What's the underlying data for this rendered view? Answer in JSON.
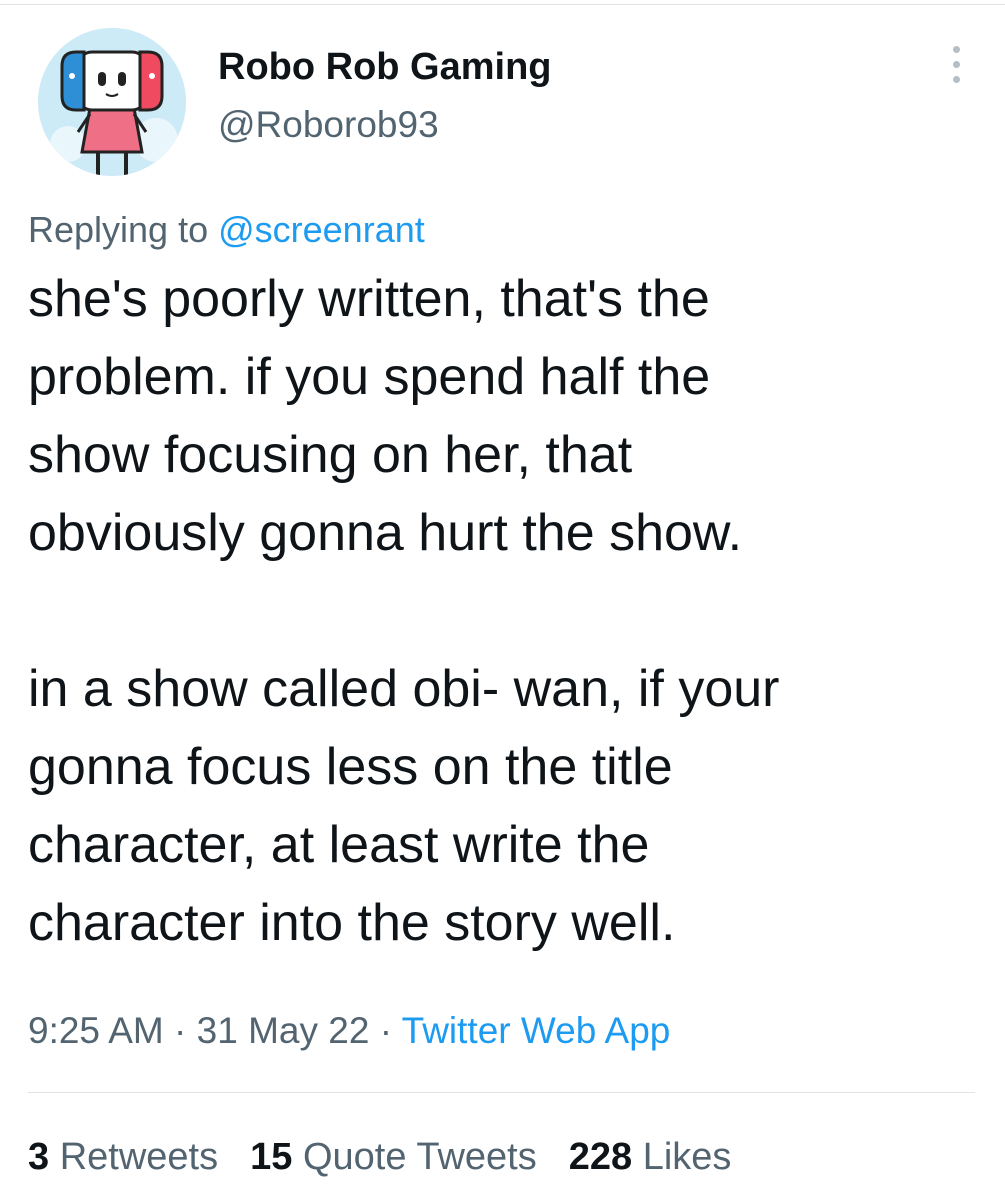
{
  "tweet": {
    "display_name": "Robo Rob Gaming",
    "handle": "@Roborob93",
    "reply_prefix": "Replying to ",
    "reply_to": "@screenrant",
    "paragraphs": [
      "she's poorly written, that's the\nproblem. if you spend half the\nshow focusing on her, that\nobviously gonna hurt the show.",
      "in a show called obi- wan, if your\ngonna focus less on the title\ncharacter, at least write the\ncharacter into the story well."
    ],
    "time": "9:25 AM",
    "date": "31 May 22",
    "separator": " · ",
    "source": "Twitter Web App"
  },
  "stats": {
    "retweets_count": "3",
    "retweets_label": "Retweets",
    "quotes_count": "15",
    "quotes_label": "Quote Tweets",
    "likes_count": "228",
    "likes_label": "Likes"
  },
  "colors": {
    "text_primary": "#0f1419",
    "text_secondary": "#536471",
    "link": "#1d9bf0",
    "divider": "#e1e4e6"
  },
  "icons": {
    "avatar": "robot-avatar-icon",
    "more": "more-options-icon"
  }
}
